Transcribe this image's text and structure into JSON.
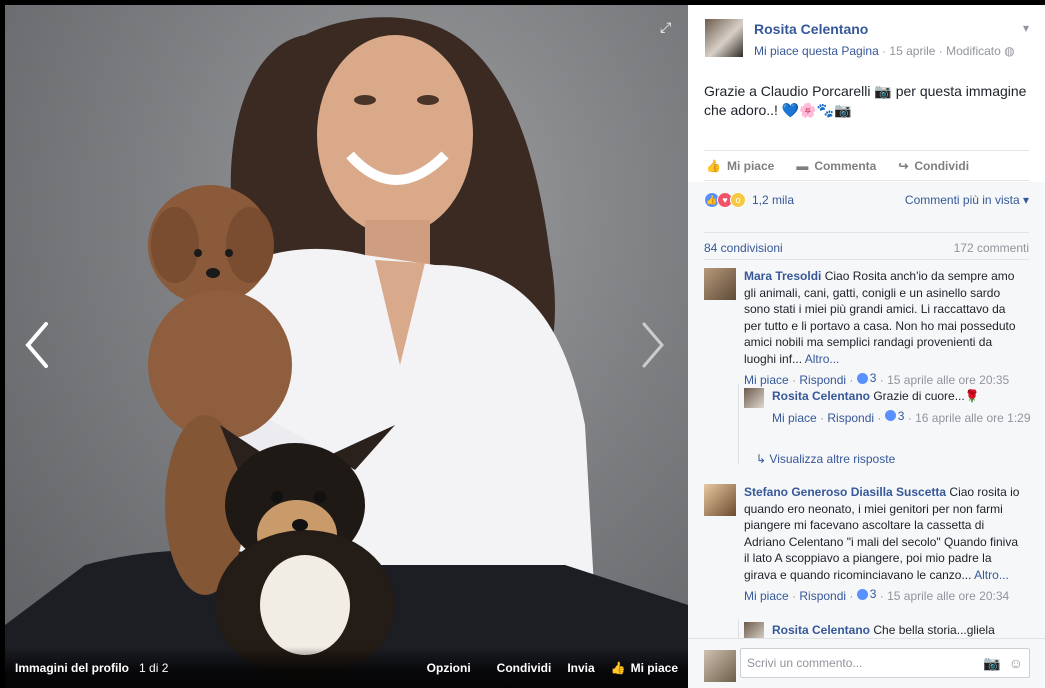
{
  "photo_viewer": {
    "album_label": "Immagini del profilo",
    "position": "1 di 2",
    "options_label": "Opzioni",
    "share_label": "Condividi",
    "send_label": "Invia",
    "like_label": "Mi piace"
  },
  "post": {
    "page_name": "Rosita Celentano",
    "like_page_label": "Mi piace questa Pagina",
    "meta_sep": " · ",
    "date": "15 aprile",
    "edited": "Modificato",
    "text": "Grazie a Claudio Porcarelli 📷 per questa immagine che adoro..! 💙🌸🐾📷",
    "actions": {
      "like": "Mi piace",
      "comment": "Commenta",
      "share": "Condividi"
    },
    "reactions_total": "1,2 mila",
    "comment_order": "Commenti più in vista",
    "shares": "84 condivisioni",
    "comments_count": "172 commenti"
  },
  "comments": [
    {
      "author": "Mara Tresoldi",
      "text": " Ciao Rosita anch'io da sempre amo gli animali, cani, gatti, conigli e un asinello sardo sono stati i miei più grandi amici. Li raccattavo da per tutto e li portavo a casa. Non ho mai posseduto amici nobili ma semplici randagi provenienti da luoghi inf...",
      "more": "Altro...",
      "like": "Mi piace",
      "reply": "Rispondi",
      "likes": "3",
      "time": "15 aprile alle ore 20:35"
    },
    {
      "author": "Stefano Generoso Diasilla Suscetta",
      "text": " Ciao rosita io quando ero neonato, i miei genitori per non farmi piangere mi facevano ascoltare la cassetta di Adriano Celentano \"i mali del secolo\" Quando finiva il lato A scoppiavo a piangere, poi mio padre la girava e quando ricominciavano le canzo...",
      "more": "Altro...",
      "like": "Mi piace",
      "reply": "Rispondi",
      "likes": "3",
      "time": "15 aprile alle ore 20:34"
    }
  ],
  "replies": [
    {
      "author": "Rosita Celentano",
      "text": " Grazie di cuore...🌹",
      "like": "Mi piace",
      "reply": "Rispondi",
      "likes": "3",
      "time": "16 aprile alle ore 1:29"
    },
    {
      "author": "Rosita Celentano",
      "text": " Che bella storia...gliela"
    }
  ],
  "more_replies": "Visualizza altre risposte",
  "composer": {
    "placeholder": "Scrivi un commento..."
  },
  "colors": {
    "link": "#365899",
    "muted": "#90949c",
    "like_blue": "#5890ff",
    "love_red": "#f25268"
  }
}
